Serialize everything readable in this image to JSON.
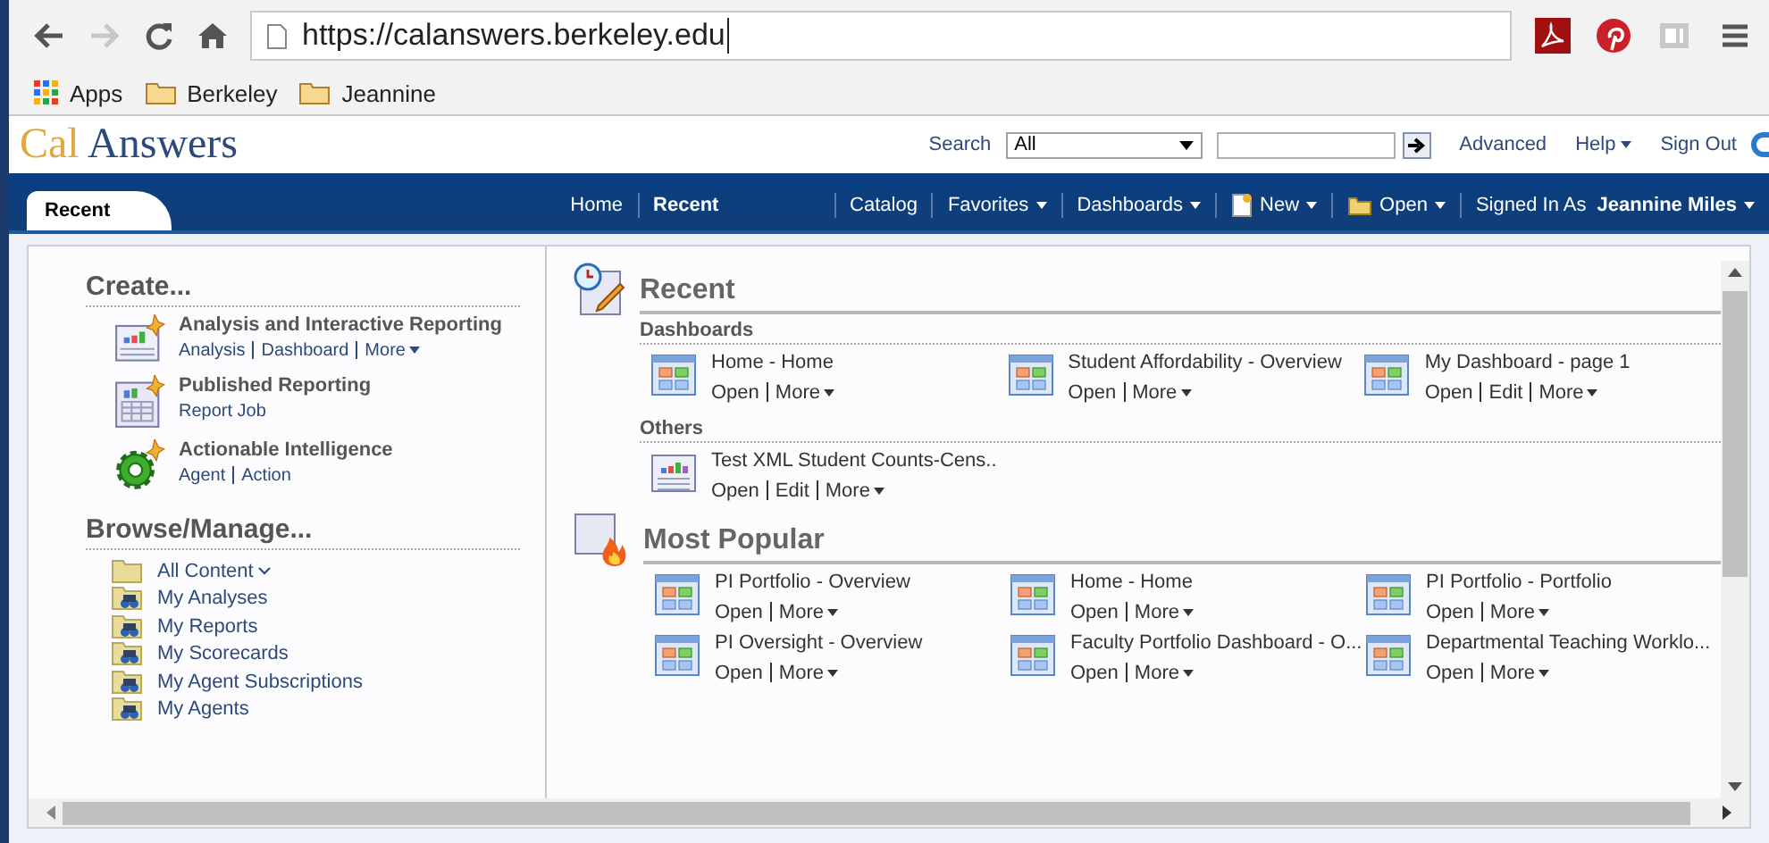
{
  "browser": {
    "url": "https://calanswers.berkeley.edu",
    "bookmarks": [
      {
        "label": "Apps",
        "kind": "apps"
      },
      {
        "label": "Berkeley",
        "kind": "folder"
      },
      {
        "label": "Jeannine",
        "kind": "folder"
      }
    ]
  },
  "header": {
    "logo_first": "Cal",
    "logo_second": "Answers",
    "search_label": "Search",
    "search_scope": "All",
    "links": [
      {
        "label": "Advanced",
        "menu": false
      },
      {
        "label": "Help",
        "menu": true
      },
      {
        "label": "Sign Out",
        "menu": false
      }
    ]
  },
  "tabs": [
    {
      "label": "Recent",
      "selected": true
    }
  ],
  "nav": [
    {
      "label": "Home",
      "selected": false,
      "menu": false,
      "kind": "plain"
    },
    {
      "label": "Recent",
      "selected": true,
      "menu": false,
      "kind": "plain"
    },
    {
      "label": "Catalog",
      "selected": false,
      "menu": false,
      "kind": "plain"
    },
    {
      "label": "Favorites",
      "selected": false,
      "menu": true,
      "kind": "plain"
    },
    {
      "label": "Dashboards",
      "selected": false,
      "menu": true,
      "kind": "plain"
    },
    {
      "label": "New",
      "selected": false,
      "menu": true,
      "kind": "document"
    },
    {
      "label": "Open",
      "selected": false,
      "menu": true,
      "kind": "folder"
    }
  ],
  "signed_in": {
    "label": "Signed In As",
    "user": "Jeannine Miles"
  },
  "create": {
    "title": "Create...",
    "items": [
      {
        "title": "Analysis and Interactive Reporting",
        "kind": "analysis",
        "links": [
          {
            "label": "Analysis",
            "menu": false
          },
          {
            "label": "Dashboard",
            "menu": false
          },
          {
            "label": "More",
            "menu": true
          }
        ]
      },
      {
        "title": "Published Reporting",
        "kind": "report",
        "links": [
          {
            "label": "Report Job",
            "menu": false
          }
        ]
      },
      {
        "title": "Actionable Intelligence",
        "kind": "agent",
        "links": [
          {
            "label": "Agent",
            "menu": false
          },
          {
            "label": "Action",
            "menu": false
          }
        ]
      }
    ]
  },
  "browse": {
    "title": "Browse/Manage...",
    "items": [
      {
        "label": "All Content",
        "kind": "folder",
        "menu": true
      },
      {
        "label": "My Analyses",
        "kind": "shared",
        "menu": false
      },
      {
        "label": "My Reports",
        "kind": "shared",
        "menu": false
      },
      {
        "label": "My Scorecards",
        "kind": "shared",
        "menu": false
      },
      {
        "label": "My Agent Subscriptions",
        "kind": "shared",
        "menu": false
      },
      {
        "label": "My Agents",
        "kind": "shared",
        "menu": false
      }
    ]
  },
  "sections": [
    {
      "title": "Recent",
      "kind": "recent",
      "groups": [
        {
          "title": "Dashboards",
          "items": [
            {
              "title": "Home - Home",
              "kind": "dashboard",
              "actions": [
                {
                  "label": "Open",
                  "menu": false
                },
                {
                  "label": "More",
                  "menu": true
                }
              ]
            },
            {
              "title": "Student Affordability - Overview",
              "kind": "dashboard",
              "actions": [
                {
                  "label": "Open",
                  "menu": false
                },
                {
                  "label": "More",
                  "menu": true
                }
              ]
            },
            {
              "title": "My Dashboard - page 1",
              "kind": "dashboard",
              "actions": [
                {
                  "label": "Open",
                  "menu": false
                },
                {
                  "label": "Edit",
                  "menu": false
                },
                {
                  "label": "More",
                  "menu": true
                }
              ]
            }
          ]
        },
        {
          "title": "Others",
          "items": [
            {
              "title": "Test XML Student Counts-Cens..",
              "kind": "analysis",
              "actions": [
                {
                  "label": "Open",
                  "menu": false
                },
                {
                  "label": "Edit",
                  "menu": false
                },
                {
                  "label": "More",
                  "menu": true
                }
              ]
            }
          ]
        }
      ]
    },
    {
      "title": "Most Popular",
      "kind": "popular",
      "groups": [
        {
          "items": [
            {
              "title": "PI Portfolio - Overview",
              "kind": "dashboard",
              "actions": [
                {
                  "label": "Open",
                  "menu": false
                },
                {
                  "label": "More",
                  "menu": true
                }
              ]
            },
            {
              "title": "Home - Home",
              "kind": "dashboard",
              "actions": [
                {
                  "label": "Open",
                  "menu": false
                },
                {
                  "label": "More",
                  "menu": true
                }
              ]
            },
            {
              "title": "PI Portfolio - Portfolio",
              "kind": "dashboard",
              "actions": [
                {
                  "label": "Open",
                  "menu": false
                },
                {
                  "label": "More",
                  "menu": true
                }
              ]
            },
            {
              "title": "PI Oversight - Overview",
              "kind": "dashboard",
              "actions": [
                {
                  "label": "Open",
                  "menu": false
                },
                {
                  "label": "More",
                  "menu": true
                }
              ]
            },
            {
              "title": "Faculty Portfolio Dashboard - O...",
              "kind": "dashboard",
              "actions": [
                {
                  "label": "Open",
                  "menu": false
                },
                {
                  "label": "More",
                  "menu": true
                }
              ]
            },
            {
              "title": "Departmental Teaching Worklo...",
              "kind": "dashboard",
              "actions": [
                {
                  "label": "Open",
                  "menu": false
                },
                {
                  "label": "More",
                  "menu": true
                }
              ]
            }
          ]
        }
      ]
    }
  ]
}
